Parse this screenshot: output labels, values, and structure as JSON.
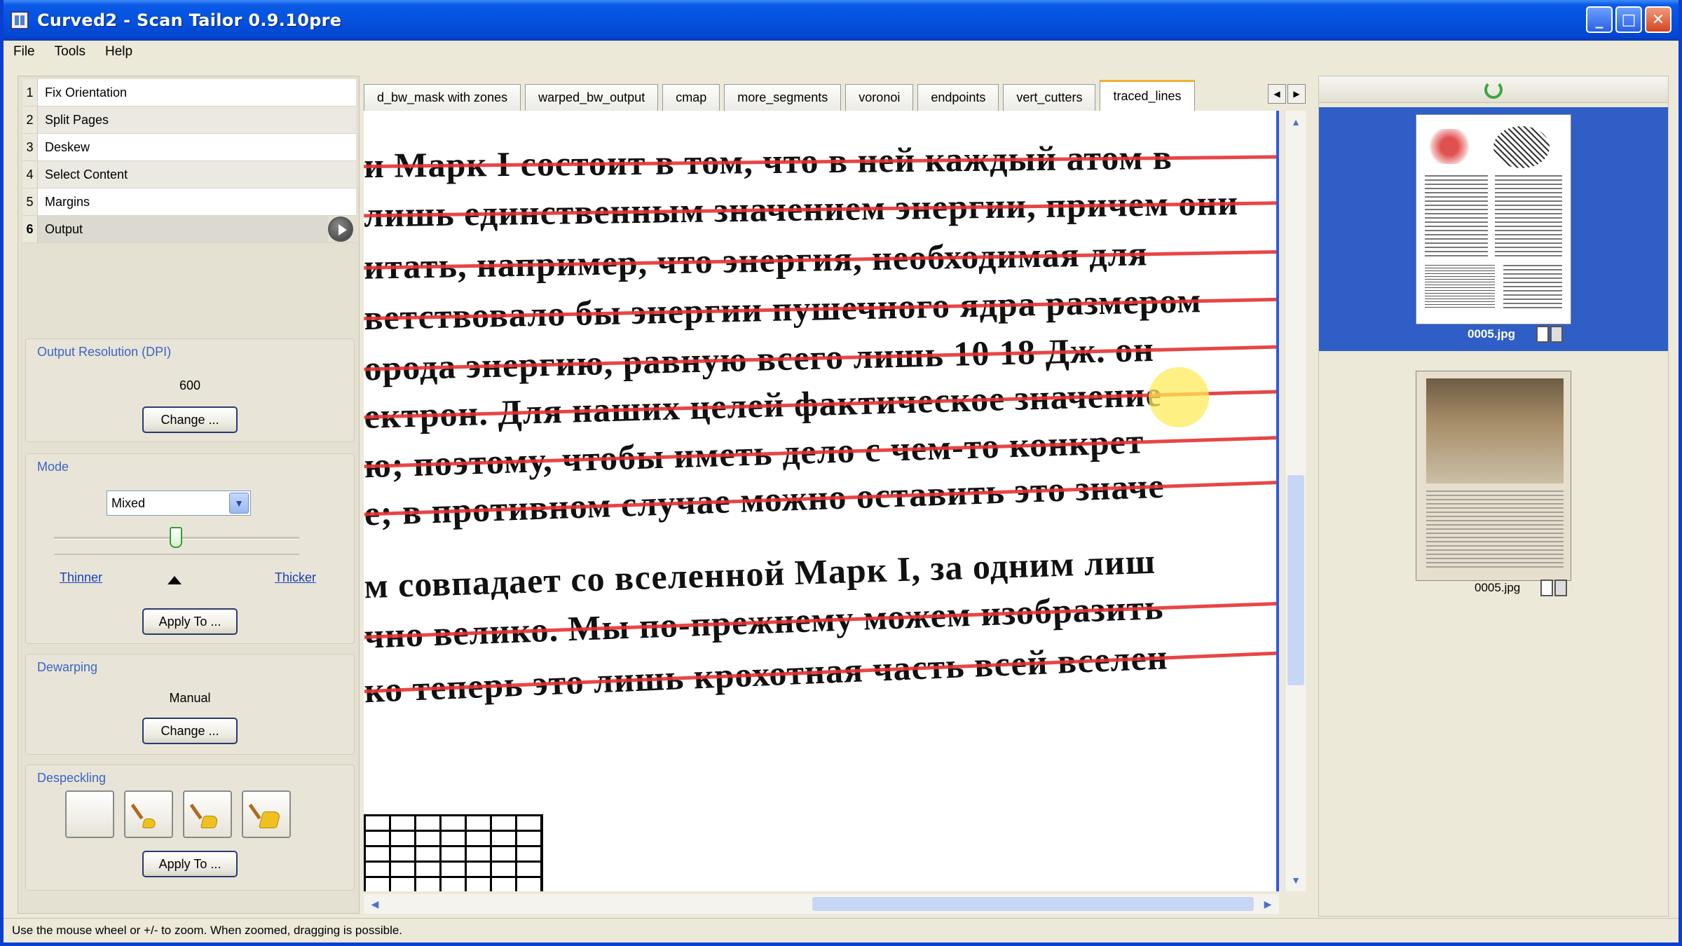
{
  "window": {
    "title": "Curved2 - Scan Tailor 0.9.10pre",
    "minimize_glyph": "_",
    "maximize_glyph": "□",
    "close_glyph": "✕"
  },
  "menu": [
    "File",
    "Tools",
    "Help"
  ],
  "stages": [
    {
      "num": "1",
      "label": "Fix Orientation"
    },
    {
      "num": "2",
      "label": "Split Pages"
    },
    {
      "num": "3",
      "label": "Deskew"
    },
    {
      "num": "4",
      "label": "Select Content"
    },
    {
      "num": "5",
      "label": "Margins"
    },
    {
      "num": "6",
      "label": "Output"
    }
  ],
  "options": {
    "resolution": {
      "title": "Output Resolution (DPI)",
      "value": "600",
      "change_label": "Change ..."
    },
    "mode": {
      "title": "Mode",
      "selected": "Mixed",
      "thinner_label": "Thinner",
      "thicker_label": "Thicker",
      "apply_label": "Apply To ...",
      "slider_value": 0.5
    },
    "dewarping": {
      "title": "Dewarping",
      "value": "Manual",
      "change_label": "Change ..."
    },
    "despeckling": {
      "title": "Despeckling",
      "apply_label": "Apply To ..."
    }
  },
  "tabs": [
    "d_bw_mask with zones",
    "warped_bw_output",
    "cmap",
    "more_segments",
    "voronoi",
    "endpoints",
    "vert_cutters",
    "traced_lines"
  ],
  "active_tab": "traced_lines",
  "document_lines": [
    "и Марк I состоит в том, что в ней каждый атом в",
    "лишь единственным значением энергии, причем они",
    "итать, например, что энергия, необходимая для",
    "ветствовало бы энергии пушечного ядра размером",
    "орода энергию, равную всего лишь 10 18 Дж. он",
    "ектрон. Для наших целей фактическое значение",
    "ю; поэтому, чтобы иметь дело с чем-то конкрет",
    "е; в противном случае можно оставить это значе",
    "м совпадает со вселенной Марк I, за одним лиш",
    "чно велико. Мы по-прежнему можем изобразить",
    "ко теперь это лишь крохотная часть всей вселен"
  ],
  "thumbnails": [
    {
      "label": "0005.jpg",
      "selected": true
    },
    {
      "label": "0005.jpg",
      "selected": false
    }
  ],
  "statusbar": {
    "text": "Use the mouse wheel or +/- to zoom.  When zoomed, dragging is possible."
  },
  "colors": {
    "accent": "#2f5ec6",
    "traced_line": "#e63232",
    "titlebar": "#0452de"
  }
}
